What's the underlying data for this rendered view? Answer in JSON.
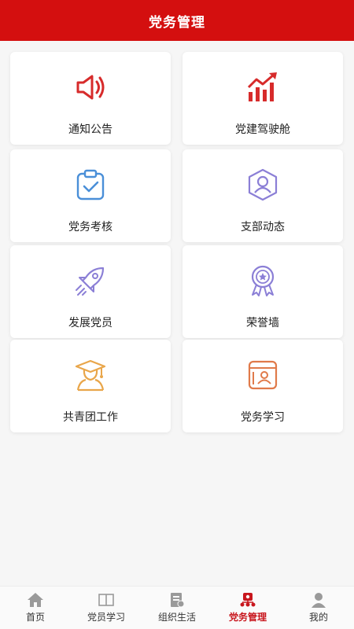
{
  "header": {
    "title": "党务管理"
  },
  "menu": [
    {
      "label": "通知公告",
      "icon": "speaker-icon"
    },
    {
      "label": "党建驾驶舱",
      "icon": "bar-chart-icon"
    },
    {
      "label": "党务考核",
      "icon": "clipboard-check-icon"
    },
    {
      "label": "支部动态",
      "icon": "user-hexagon-icon"
    },
    {
      "label": "发展党员",
      "icon": "rocket-icon"
    },
    {
      "label": "荣誉墙",
      "icon": "award-medal-icon"
    },
    {
      "label": "共青团工作",
      "icon": "graduate-icon"
    },
    {
      "label": "党务学习",
      "icon": "id-card-icon"
    }
  ],
  "tabbar": {
    "items": [
      {
        "label": "首页",
        "icon": "home-icon"
      },
      {
        "label": "党员学习",
        "icon": "book-icon"
      },
      {
        "label": "组织生活",
        "icon": "document-icon"
      },
      {
        "label": "党务管理",
        "icon": "party-badge-icon"
      },
      {
        "label": "我的",
        "icon": "person-icon"
      }
    ],
    "active_index": 3
  },
  "colors": {
    "primary_red": "#d40f0f",
    "icon_red": "#d72b2b",
    "icon_blue": "#4a8fd8",
    "icon_purple": "#8b7fd6",
    "icon_orange": "#e9a64a",
    "tab_inactive": "#999999"
  }
}
